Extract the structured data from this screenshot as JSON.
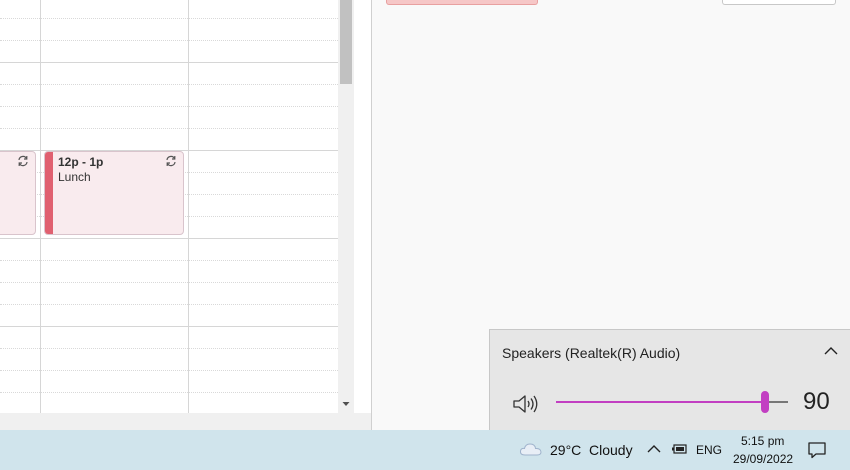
{
  "calendar": {
    "events": [
      {
        "time": "",
        "title": "",
        "has_repeat": true
      },
      {
        "time": "12p - 1p",
        "title": "Lunch",
        "has_repeat": true
      }
    ]
  },
  "volume_flyout": {
    "device_name": "Speakers (Realtek(R) Audio)",
    "volume": "90",
    "volume_percent": 90,
    "accent_color": "#c23fc2"
  },
  "taskbar": {
    "weather": {
      "temperature": "29°C",
      "condition": "Cloudy",
      "icon": "cloud-icon"
    },
    "language": "ENG",
    "time": "5:15 pm",
    "date": "29/09/2022",
    "icons": [
      "show-hidden-icons-caret-icon",
      "battery-icon",
      "notification-icon"
    ]
  }
}
